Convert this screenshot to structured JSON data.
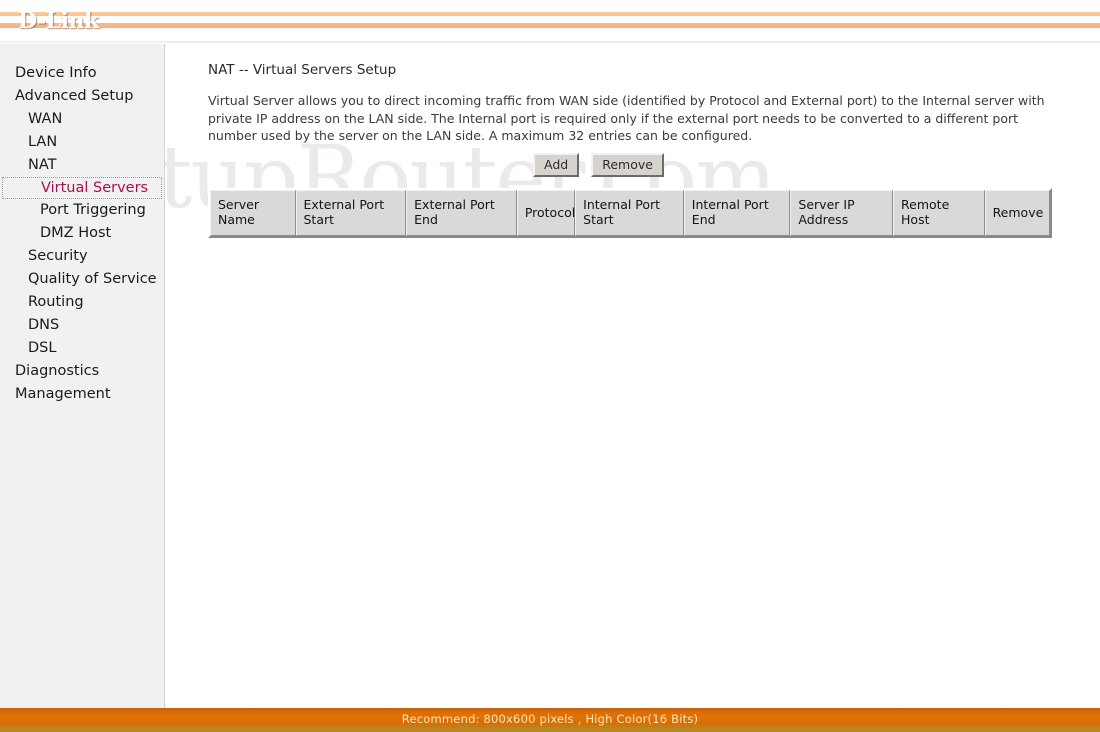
{
  "header": {
    "logo": "D-Link"
  },
  "watermark": {
    "text": "SetupRouter.com"
  },
  "sidebar": {
    "items": [
      {
        "label": "Device Info",
        "level": 1,
        "active": false
      },
      {
        "label": "Advanced Setup",
        "level": 1,
        "active": false
      },
      {
        "label": "WAN",
        "level": 2,
        "active": false
      },
      {
        "label": "LAN",
        "level": 2,
        "active": false
      },
      {
        "label": "NAT",
        "level": 2,
        "active": false
      },
      {
        "label": "Virtual Servers",
        "level": 3,
        "active": true
      },
      {
        "label": "Port Triggering",
        "level": 3,
        "active": false
      },
      {
        "label": "DMZ Host",
        "level": 3,
        "active": false
      },
      {
        "label": "Security",
        "level": 2,
        "active": false
      },
      {
        "label": "Quality of Service",
        "level": 2,
        "active": false
      },
      {
        "label": "Routing",
        "level": 2,
        "active": false
      },
      {
        "label": "DNS",
        "level": 2,
        "active": false
      },
      {
        "label": "DSL",
        "level": 2,
        "active": false
      },
      {
        "label": "Diagnostics",
        "level": 1,
        "active": false
      },
      {
        "label": "Management",
        "level": 1,
        "active": false
      }
    ],
    "active_color": "#a81050"
  },
  "main": {
    "title": "NAT -- Virtual Servers Setup",
    "description": "Virtual Server allows you to direct incoming traffic from WAN side (identified by Protocol and External port) to the Internal server with private IP address on the LAN side. The Internal port is required only if the external port needs to be converted to a different port number used by the server on the LAN side. A maximum 32 entries can be configured.",
    "buttons": {
      "add": "Add",
      "remove": "Remove"
    },
    "table": {
      "columns": [
        "Server Name",
        "External Port Start",
        "External Port End",
        "Protocol",
        "Internal Port Start",
        "Internal Port End",
        "Server IP Address",
        "Remote Host",
        "Remove"
      ],
      "rows": []
    }
  },
  "footer": {
    "text": "Recommend: 800x600 pixels , High Color(16 Bits)"
  }
}
